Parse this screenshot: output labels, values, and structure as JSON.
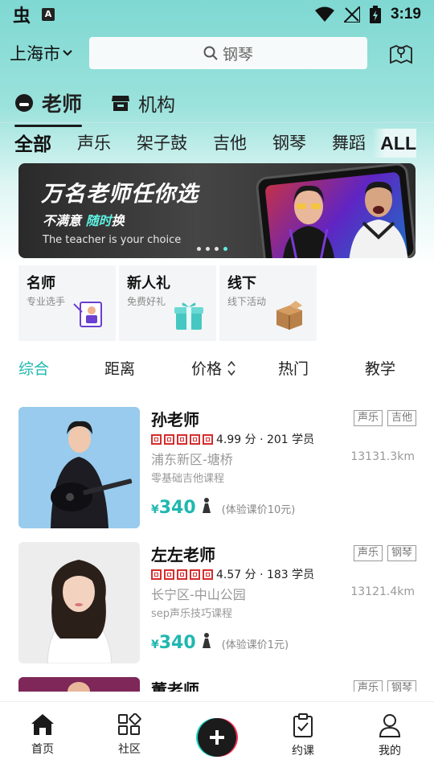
{
  "status_bar": {
    "logo": "虫",
    "notif": "A",
    "time": "3:19"
  },
  "top_bar": {
    "city": "上海市",
    "search_placeholder": "钢琴"
  },
  "main_tabs": [
    {
      "label": "老师",
      "active": true,
      "icon": "teacher-icon"
    },
    {
      "label": "机构",
      "active": false,
      "icon": "store-icon"
    }
  ],
  "sub_tabs": [
    "全部",
    "声乐",
    "架子鼓",
    "吉他",
    "钢琴",
    "舞蹈"
  ],
  "sub_tabs_all": "ALL",
  "banner": {
    "title": "万名老师任你选",
    "sub_a": "不满意",
    "sub_b": "随时",
    "sub_c": "换",
    "english": "The teacher is your choice"
  },
  "features": [
    {
      "title": "名师",
      "sub": "专业选手",
      "icon": "teacher-board-icon"
    },
    {
      "title": "新人礼",
      "sub": "免费好礼",
      "icon": "gift-icon"
    },
    {
      "title": "线下",
      "sub": "线下活动",
      "icon": "box-icon"
    }
  ],
  "sort": {
    "s0": "综合",
    "s1": "距离",
    "s2": "价格",
    "s3": "热门",
    "s4": "教学"
  },
  "teachers": [
    {
      "name": "孙老师",
      "tags": [
        "声乐",
        "吉他"
      ],
      "rating": "4.99 分 · 201 学员",
      "area": "浦东新区-塘桥",
      "distance": "13131.3km",
      "course": "零基础吉他课程",
      "currency": "¥",
      "price": "340",
      "trial": "(体验课价10元)"
    },
    {
      "name": "左左老师",
      "tags": [
        "声乐",
        "钢琴"
      ],
      "rating": "4.57 分 · 183 学员",
      "area": "长宁区-中山公园",
      "distance": "13121.4km",
      "course": "sep声乐技巧课程",
      "currency": "¥",
      "price": "340",
      "trial": "(体验课价1元)"
    },
    {
      "name": "董老师",
      "tags": [
        "声乐",
        "钢琴"
      ]
    }
  ],
  "bottom_nav": [
    {
      "label": "首页",
      "icon": "home-icon",
      "active": true
    },
    {
      "label": "社区",
      "icon": "grid-icon"
    },
    {
      "label": "约课",
      "icon": "clipboard-icon"
    },
    {
      "label": "我的",
      "icon": "user-icon"
    }
  ],
  "colors": {
    "accent": "#1fb8b0",
    "header_teal": "#7fd8d2",
    "star_red": "#d62d2d"
  }
}
